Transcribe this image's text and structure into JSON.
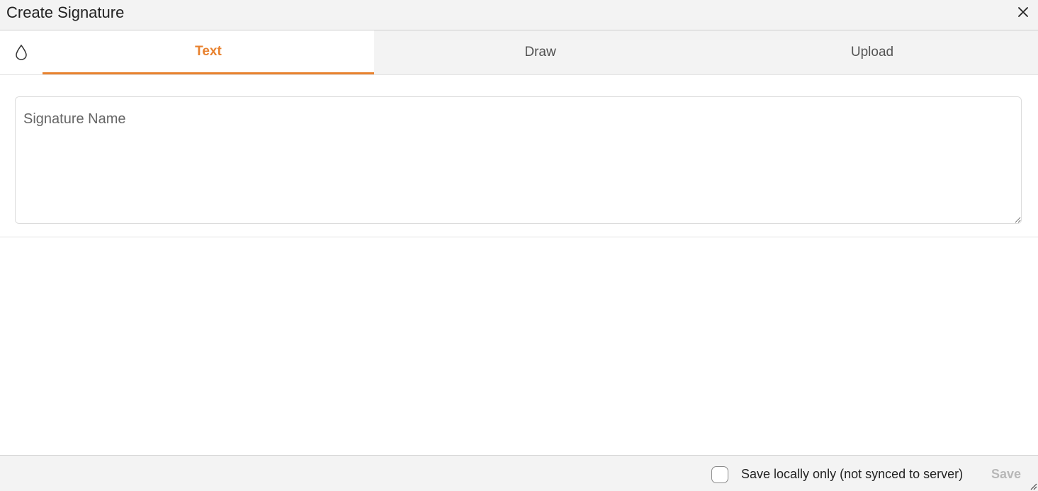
{
  "dialog": {
    "title": "Create Signature",
    "close_icon": "close-icon"
  },
  "tabs": {
    "color_icon": "droplet-icon",
    "items": [
      {
        "label": "Text",
        "active": true
      },
      {
        "label": "Draw",
        "active": false
      },
      {
        "label": "Upload",
        "active": false
      }
    ]
  },
  "signature_field": {
    "placeholder": "Signature Name",
    "value": ""
  },
  "footer": {
    "save_locally_label": "Save locally only (not synced to server)",
    "save_locally_checked": false,
    "save_label": "Save"
  },
  "colors": {
    "accent": "#e8822f",
    "header_bg": "#f3f3f3",
    "disabled_text": "#b8b8b8"
  }
}
